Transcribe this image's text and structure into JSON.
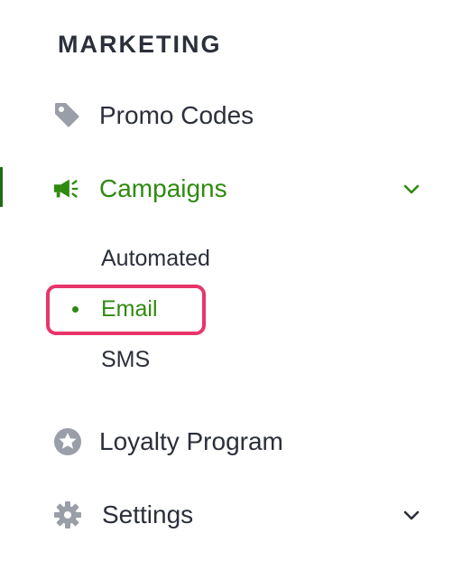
{
  "sidebar": {
    "section_title": "MARKETING",
    "items": [
      {
        "label": "Promo Codes",
        "icon": "tag-icon",
        "active": false
      },
      {
        "label": "Campaigns",
        "icon": "megaphone-icon",
        "active": true,
        "expanded": true,
        "children": [
          {
            "label": "Automated",
            "active": false
          },
          {
            "label": "Email",
            "active": true
          },
          {
            "label": "SMS",
            "active": false
          }
        ]
      },
      {
        "label": "Loyalty Program",
        "icon": "star-circle-icon",
        "active": false
      },
      {
        "label": "Settings",
        "icon": "gear-icon",
        "active": false,
        "expanded": false
      }
    ]
  },
  "colors": {
    "active": "#2f8a10",
    "text": "#2b2f3a",
    "icon_gray": "#9a9ea8",
    "highlight": "#e8356a"
  }
}
